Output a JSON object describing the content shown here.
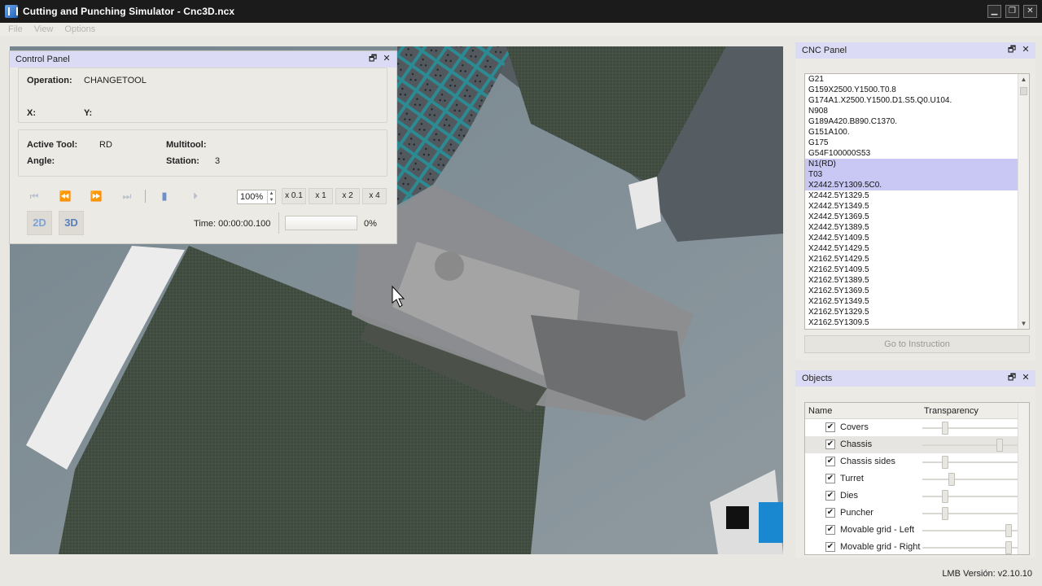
{
  "window": {
    "title": "Cutting and Punching Simulator - Cnc3D.ncx",
    "minimize": "▁",
    "restore": "❐",
    "close": "✕"
  },
  "menu": [
    "File",
    "View",
    "Options"
  ],
  "control_panel": {
    "title": "Control Panel",
    "operation_label": "Operation:",
    "operation_value": "CHANGETOOL",
    "x_label": "X:",
    "y_label": "Y:",
    "active_tool_label": "Active Tool:",
    "active_tool_value": "RD",
    "multitool_label": "Multitool:",
    "angle_label": "Angle:",
    "station_label": "Station:",
    "station_value": "3",
    "zoom_value": "100%",
    "speeds": [
      "x 0.1",
      "x 1",
      "x 2",
      "x 4"
    ],
    "mode_2d": "2D",
    "mode_3d": "3D",
    "time_label": "Time: 00:00:00.100",
    "progress_text": "0%",
    "progress": 0
  },
  "cnc_panel": {
    "title": "CNC Panel",
    "lines": [
      "G21",
      "G159X2500.Y1500.T0.8",
      "G174A1.X2500.Y1500.D1.S5.Q0.U104.",
      "N908",
      "G189A420.B890.C1370.",
      "G151A100.",
      "G175",
      "G54F100000S53",
      "N1(RD)",
      "T03",
      "X2442.5Y1309.5C0.",
      "X2442.5Y1329.5",
      "X2442.5Y1349.5",
      "X2442.5Y1369.5",
      "X2442.5Y1389.5",
      "X2442.5Y1409.5",
      "X2442.5Y1429.5",
      "X2162.5Y1429.5",
      "X2162.5Y1409.5",
      "X2162.5Y1389.5",
      "X2162.5Y1369.5",
      "X2162.5Y1349.5",
      "X2162.5Y1329.5",
      "X2162.5Y1309.5"
    ],
    "selected_lines": [
      8,
      9,
      10
    ],
    "goto_button": "Go to Instruction"
  },
  "objects_panel": {
    "title": "Objects",
    "col_name": "Name",
    "col_transparency": "Transparency",
    "items": [
      {
        "name": "Covers",
        "checked": "✔",
        "transparency": 0.25
      },
      {
        "name": "Chassis",
        "checked": "✔",
        "transparency": 0.85
      },
      {
        "name": "Chassis sides",
        "checked": "✔",
        "transparency": 0.25
      },
      {
        "name": "Turret",
        "checked": "✔",
        "transparency": 0.32
      },
      {
        "name": "Dies",
        "checked": "✔",
        "transparency": 0.25
      },
      {
        "name": "Puncher",
        "checked": "✔",
        "transparency": 0.25
      },
      {
        "name": "Movable grid - Left",
        "checked": "✔",
        "transparency": 0.95
      },
      {
        "name": "Movable grid - Right",
        "checked": "✔",
        "transparency": 0.95
      }
    ]
  },
  "status_bar": "LMB Versión: v2.10.10",
  "icons": {
    "float": "🗗",
    "close": "✕"
  },
  "colors": {
    "panel_header": "#dcdbf5",
    "selection": "#c9c7f3",
    "title_bar": "#1b1b1b"
  }
}
